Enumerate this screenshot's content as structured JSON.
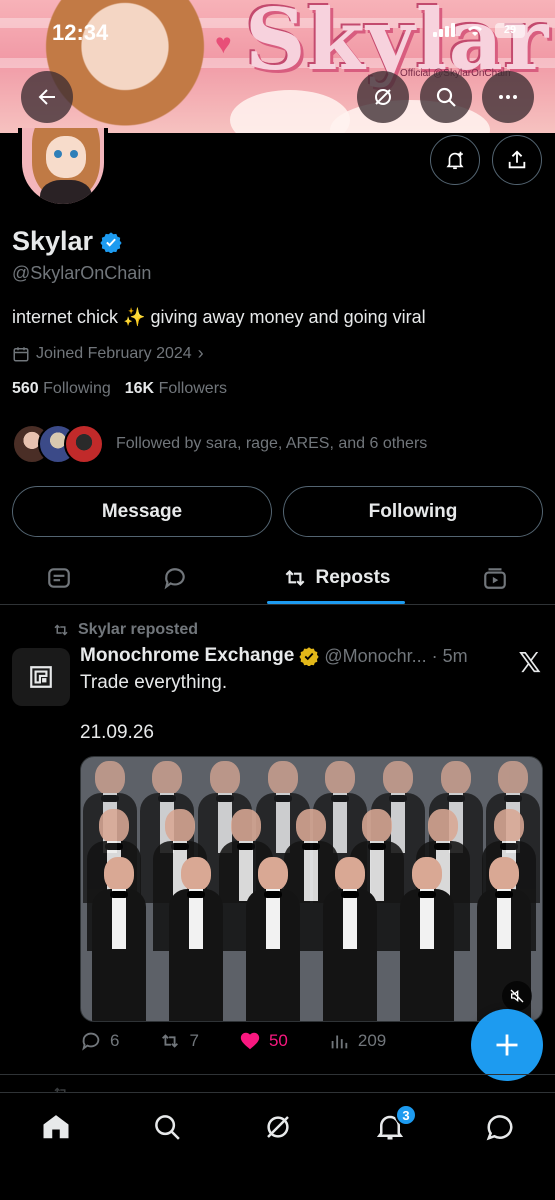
{
  "status_bar": {
    "time": "12:34",
    "battery": "29"
  },
  "banner": {
    "wordmark": "Skylar",
    "official_text": "Official @SkylarOnChain"
  },
  "header_buttons": {
    "back_icon": "arrow-left-icon",
    "grok_icon": "grok-icon",
    "search_icon": "search-icon",
    "more_icon": "more-icon"
  },
  "profile": {
    "name": "Skylar",
    "handle": "@SkylarOnChain",
    "bio": "internet chick ✨ giving away money and going viral",
    "joined": "Joined February 2024",
    "following_count": "560",
    "following_label": "Following",
    "followers_count": "16K",
    "followers_label": "Followers",
    "followed_by": "Followed by sara, rage, ARES, and 6 others",
    "verified_color": "#1d9bf0"
  },
  "buttons": {
    "message": "Message",
    "following": "Following"
  },
  "tabs": {
    "active_label": "Reposts"
  },
  "post": {
    "repost_label": "Skylar reposted",
    "author": "Monochrome Exchange",
    "handle_time": "@Monochr... · 5m",
    "text": "Trade everything.",
    "date": "21.09.26",
    "replies": "6",
    "reposts": "7",
    "likes": "50",
    "views": "209",
    "gold_verified_color": "#e2b719"
  },
  "notifications_badge": "3",
  "colors": {
    "accent": "#1d9bf0",
    "like": "#f91880",
    "muted": "#71767b"
  }
}
